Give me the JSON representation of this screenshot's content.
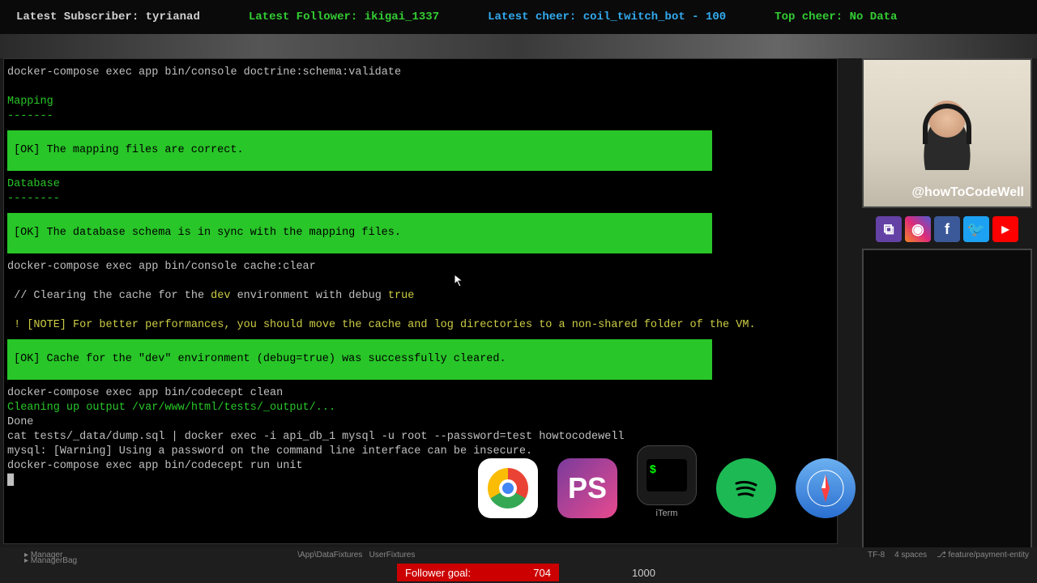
{
  "topbar": {
    "subscriber_label": "Latest Subscriber: ",
    "subscriber_value": "tyrianad",
    "follower_label": "Latest Follower: ",
    "follower_value": "ikigai_1337",
    "cheer_label": "Latest cheer: ",
    "cheer_value": "coil_twitch_bot - 100",
    "topcheer_label": "Top cheer: ",
    "topcheer_value": "No Data"
  },
  "terminal": {
    "cmd1": "docker-compose exec app bin/console doctrine:schema:validate",
    "mapping_h": "Mapping",
    "mapping_u": "-------",
    "ok1": " [OK] The mapping files are correct.",
    "db_h": "Database",
    "db_u": "--------",
    "ok2": " [OK] The database schema is in sync with the mapping files.",
    "cmd2": "docker-compose exec app bin/console cache:clear",
    "clear_pre": " // Clearing the cache for the ",
    "clear_env": "dev",
    "clear_mid": " environment with debug ",
    "clear_true": "true",
    "note": " ! [NOTE] For better performances, you should move the cache and log directories to a non-shared folder of the VM.",
    "ok3": " [OK] Cache for the \"dev\" environment (debug=true) was successfully cleared.",
    "cmd3": "docker-compose exec app bin/codecept clean",
    "cleanup": "Cleaning up output /var/www/html/tests/_output/...",
    "done": "Done",
    "cmd4": "cat tests/_data/dump.sql | docker exec -i api_db_1 mysql -u root --password=test howtocodewell",
    "warn": "mysql: [Warning] Using a password on the command line interface can be insecure.",
    "cmd5": "docker-compose exec app bin/codecept run unit"
  },
  "stream": {
    "handle": "@howToCodeWell"
  },
  "dock": {
    "items": [
      "Chrome",
      "PhpStorm",
      "iTerm",
      "Spotify",
      "Safari"
    ],
    "active_label": "iTerm",
    "ps_label": "PS",
    "term_prompt": "$"
  },
  "ide": {
    "folder1": "Manager",
    "folder2": "ManagerBag",
    "crumb1": "\\App\\DataFixtures",
    "crumb2": "UserFixtures",
    "encoding": "TF-8",
    "spaces": "4 spaces",
    "branch": "feature/payment-entity"
  },
  "follower_goal": {
    "label": "Follower goal:",
    "current": "704",
    "total": "1000"
  }
}
